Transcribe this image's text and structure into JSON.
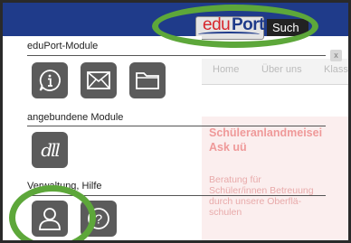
{
  "header": {
    "logo_edu": "edu",
    "logo_port": "Port",
    "search_label": "Such"
  },
  "background": {
    "tabs": [
      "Home",
      "Über uns",
      "Klassen"
    ],
    "heading_lines": [
      "Schüleranlandmeisei",
      "Ask uü"
    ],
    "text_lines": [
      "Beratung für",
      "Schüler/innen Betreuung",
      "durch unsere Oberflä-",
      "schulen"
    ],
    "close_label": "x"
  },
  "panel": {
    "sections": [
      {
        "title": "eduPort-Module",
        "tiles": [
          "info-icon",
          "mail-icon",
          "folder-icon"
        ]
      },
      {
        "title": "angebundene Module",
        "tiles": [
          "dll-logo"
        ],
        "dll_label": "dll"
      },
      {
        "title": "Verwaltung, Hilfe",
        "tiles": [
          "user-icon",
          "help-icon"
        ],
        "help_glyph": "?"
      }
    ]
  },
  "colors": {
    "header_blue": "#1f3b8a",
    "tile_gray": "#5b5b5b",
    "highlight_green": "#5da73a",
    "accent_red": "#d7262c"
  }
}
